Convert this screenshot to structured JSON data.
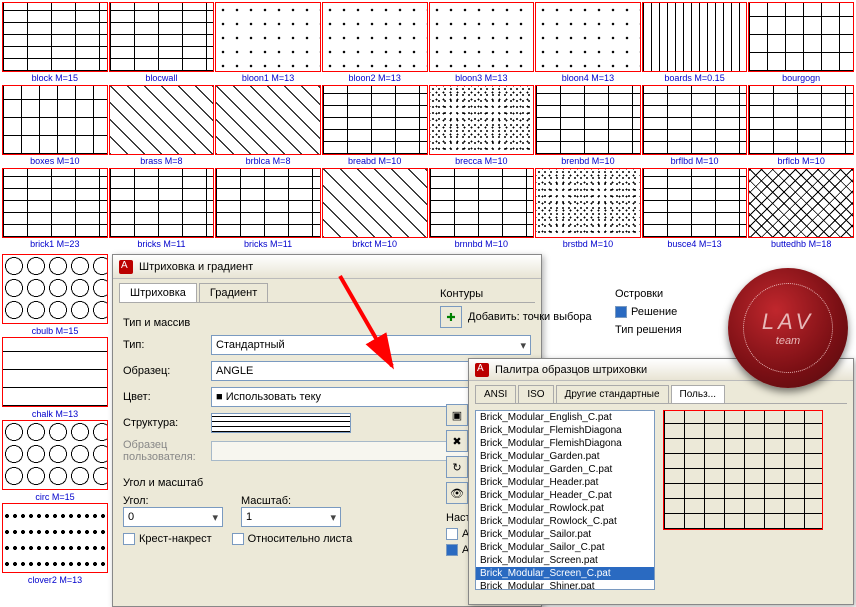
{
  "swatches_rows": [
    [
      {
        "label": "block   M=15",
        "cls": "p-brick"
      },
      {
        "label": "blocwall",
        "cls": "p-brick"
      },
      {
        "label": "bloon1   M=13",
        "cls": "p-dots"
      },
      {
        "label": "bloon2   M=13",
        "cls": "p-dots"
      },
      {
        "label": "bloon3   M=13",
        "cls": "p-dots"
      },
      {
        "label": "bloon4   M=13",
        "cls": "p-dots"
      },
      {
        "label": "boards   M=0.15",
        "cls": "p-vert"
      },
      {
        "label": "bourgogn",
        "cls": "p-boxes"
      }
    ],
    [
      {
        "label": "boxes   M=10",
        "cls": "p-boxes"
      },
      {
        "label": "brass   M=8",
        "cls": "p-diag"
      },
      {
        "label": "brblca   M=8",
        "cls": "p-diag"
      },
      {
        "label": "breabd   M=10",
        "cls": "p-brick"
      },
      {
        "label": "brecca   M=10",
        "cls": "p-noise"
      },
      {
        "label": "brenbd   M=10",
        "cls": "p-brick"
      },
      {
        "label": "brflbd   M=10",
        "cls": "p-brick"
      },
      {
        "label": "brflcb   M=10",
        "cls": "p-brick"
      }
    ],
    [
      {
        "label": "brick1   M=23",
        "cls": "p-brick"
      },
      {
        "label": "bricks   M=11",
        "cls": "p-brick"
      },
      {
        "label": "bricks   M=11",
        "cls": "p-brick"
      },
      {
        "label": "brkct   M=10",
        "cls": "p-diag"
      },
      {
        "label": "brnnbd   M=10",
        "cls": "p-brick"
      },
      {
        "label": "brstbd   M=10",
        "cls": "p-noise"
      },
      {
        "label": "busce4   M=13",
        "cls": "p-brick"
      },
      {
        "label": "buttedhb   M=18",
        "cls": "p-herring"
      }
    ]
  ],
  "left_swatches": [
    {
      "label": "cbulb   M=15",
      "cls": "p-circ"
    },
    {
      "label": "chalk   M=13",
      "cls": "p-horiz"
    },
    {
      "label": "circ   M=15",
      "cls": "p-circ"
    },
    {
      "label": "clover2   M=13",
      "cls": "p-clover"
    }
  ],
  "dialog1": {
    "title": "Штриховка и градиент",
    "tabs": [
      "Штриховка",
      "Градиент"
    ],
    "group_type": "Тип и массив",
    "type_label": "Тип:",
    "type_value": "Стандартный",
    "sample_label": "Образец:",
    "sample_value": "ANGLE",
    "color_label": "Цвет:",
    "color_value": "■ Использовать теку",
    "struct_label": "Структура:",
    "usersample_label": "Образец пользователя:",
    "angle_group": "Угол и масштаб",
    "angle_label": "Угол:",
    "angle_value": "0",
    "scale_label": "Масштаб:",
    "scale_value": "1",
    "chk_cross": "Крест-накрест",
    "chk_sheet": "Относительно листа"
  },
  "contours": {
    "title": "Контуры",
    "add": "Добавить: точки выбора"
  },
  "islands": {
    "title": "Островки",
    "chk": "Решение",
    "type": "Тип решения"
  },
  "settings_title": "Настр",
  "dialog2": {
    "title": "Палитра образцов штриховки",
    "tabs": [
      "ANSI",
      "ISO",
      "Другие стандартные",
      "Польз..."
    ],
    "items": [
      "Brick_Modular_English_C.pat",
      "Brick_Modular_FlemishDiagona",
      "Brick_Modular_FlemishDiagona",
      "Brick_Modular_Garden.pat",
      "Brick_Modular_Garden_C.pat",
      "Brick_Modular_Header.pat",
      "Brick_Modular_Header_C.pat",
      "Brick_Modular_Rowlock.pat",
      "Brick_Modular_Rowlock_C.pat",
      "Brick_Modular_Sailor.pat",
      "Brick_Modular_Sailor_C.pat",
      "Brick_Modular_Screen.pat",
      "Brick_Modular_Screen_C.pat",
      "Brick_Modular_Shiner.pat"
    ],
    "selected_index": 12
  },
  "seal": {
    "big": "LAV",
    "sm": "team"
  }
}
